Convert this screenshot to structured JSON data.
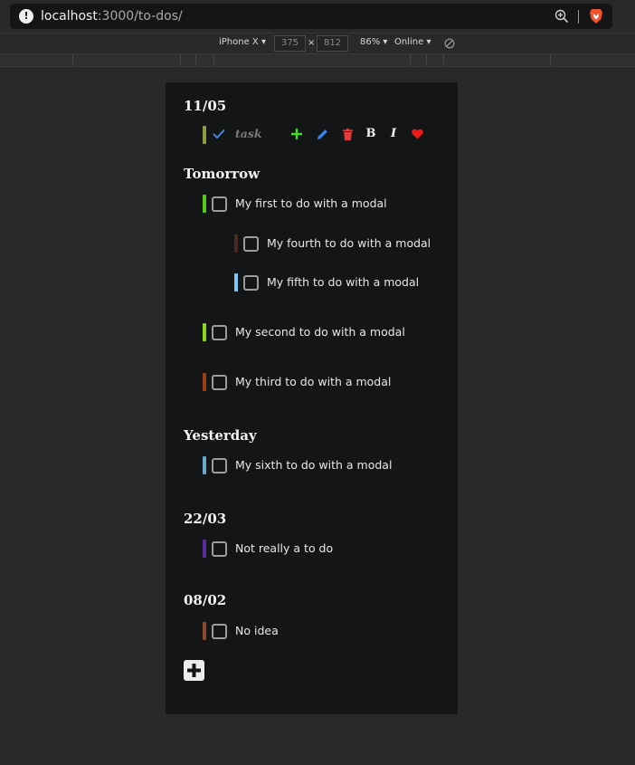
{
  "browser": {
    "host": "localhost",
    "path": ":3000/to-dos/",
    "info_glyph": "!"
  },
  "devtools": {
    "device": "iPhone X",
    "width": "375",
    "times": "×",
    "height": "812",
    "zoom": "86%",
    "network": "Online",
    "caret": "▾"
  },
  "colors": {
    "page_bg": "#292929",
    "app_bg": "#141517",
    "add_green": "#3ee31c",
    "edit_blue": "#3a86e8",
    "delete_red": "#e63b3b",
    "heart_red": "#f01a1a",
    "check_blue": "#4b8fe6"
  },
  "editing_group": {
    "heading": "11/05",
    "item": {
      "text": "task",
      "bar_color": "#8f9a3d"
    },
    "tools": {
      "add_icon": "plus-icon",
      "edit_icon": "pencil-icon",
      "delete_icon": "trash-icon",
      "bold": "B",
      "italic": "I",
      "favorite_icon": "heart-icon"
    }
  },
  "groups": [
    {
      "heading": "Tomorrow",
      "items": [
        {
          "text": "My first to do with a modal",
          "color": "#58c917"
        },
        {
          "text": "My fourth to do with a modal",
          "color": "#4a2a20"
        },
        {
          "text": "My fifth to do with a modal",
          "color": "#7cc8f2"
        },
        {
          "text": "My second to do with a modal",
          "color": "#8ed417"
        },
        {
          "text": "My third to do with a modal",
          "color": "#9a3f14"
        }
      ]
    },
    {
      "heading": "Yesterday",
      "items": [
        {
          "text": "My sixth to do with a modal",
          "color": "#6aa9c9"
        }
      ]
    },
    {
      "heading": "22/03",
      "items": [
        {
          "text": "Not really a to do",
          "color": "#5b2ca0"
        }
      ]
    },
    {
      "heading": "08/02",
      "items": [
        {
          "text": "No idea",
          "color": "#8a4a2a"
        }
      ]
    }
  ],
  "add_button_icon": "plus-icon"
}
